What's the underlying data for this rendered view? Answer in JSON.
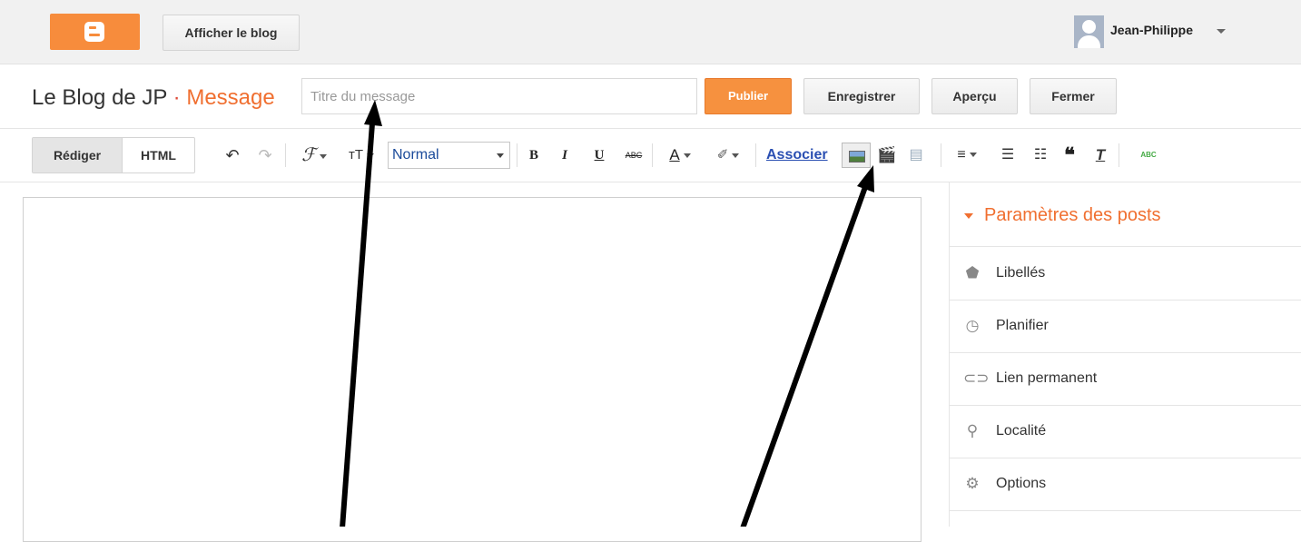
{
  "topbar": {
    "logo_icon": "blogger-logo-icon",
    "view_blog_label": "Afficher le blog",
    "user_name": "Jean-Philippe"
  },
  "post_header": {
    "blog_name": "Le Blog de JP",
    "separator": " · ",
    "section": "Message",
    "title_placeholder": "Titre du message",
    "title_value": "",
    "publish_label": "Publier",
    "save_label": "Enregistrer",
    "preview_label": "Aperçu",
    "close_label": "Fermer"
  },
  "toolbar": {
    "compose_label": "Rédiger",
    "html_label": "HTML",
    "font_select_value": "Normal",
    "link_label": "Associer",
    "icons": [
      "undo-icon",
      "redo-icon",
      "font-family-icon",
      "font-size-icon",
      "bold-icon",
      "italic-icon",
      "underline-icon",
      "strikethrough-icon",
      "text-color-icon",
      "highlight-color-icon",
      "insert-image-icon",
      "insert-video-icon",
      "jump-break-icon",
      "align-icon",
      "numbered-list-icon",
      "bulleted-list-icon",
      "quote-icon",
      "remove-formatting-icon",
      "spell-check-icon"
    ],
    "bold_glyph": "B",
    "italic_glyph": "I",
    "underline_glyph": "U",
    "strike_glyph": "ABC",
    "textcolor_glyph": "A",
    "quote_glyph": "❝",
    "clearformat_glyph": "T",
    "spell_glyph": "ABC"
  },
  "sidebar": {
    "header": "Paramètres des posts",
    "items": [
      {
        "label": "Libellés",
        "icon": "tag-icon"
      },
      {
        "label": "Planifier",
        "icon": "clock-icon"
      },
      {
        "label": "Lien permanent",
        "icon": "link-icon"
      },
      {
        "label": "Localité",
        "icon": "location-pin-icon"
      },
      {
        "label": "Options",
        "icon": "gear-icon"
      }
    ]
  },
  "colors": {
    "brand_orange": "#f78c3c",
    "accent_orange": "#f06f30",
    "link_blue": "#2a4fb2"
  }
}
